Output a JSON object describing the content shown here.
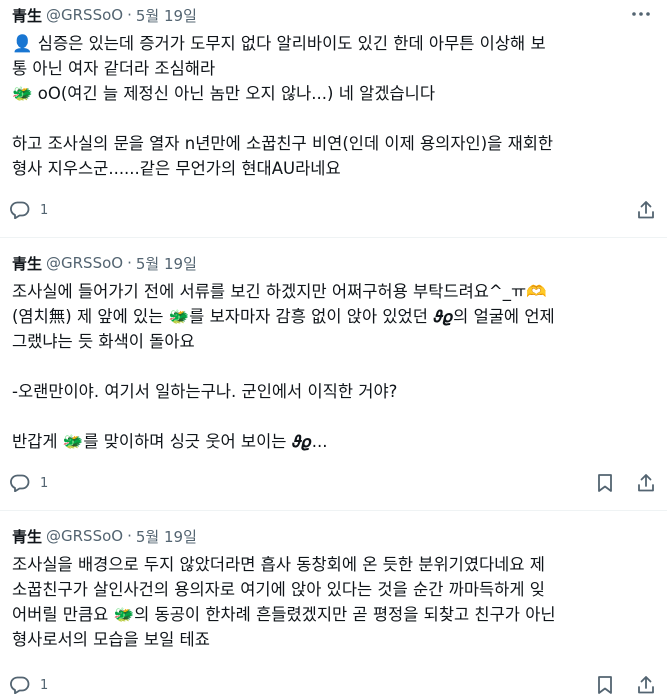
{
  "tweets": [
    {
      "name": "青生",
      "handle": "@GRSSoO",
      "dot": "·",
      "date": "5월 19일",
      "lines": [
        "👤 심증은 있는데 증거가 도무지 없다 알리바이도 있긴 한데 아무튼 이상해 보",
        "통 아닌 여자 같더라 조심해라",
        "🐲 oO(여긴 늘 제정신 아닌 놈만 오지 않나...) 네 알겠습니다",
        "",
        "하고 조사실의 문을 열자 n년만에 소꿉친구 비연(인데 이제 용의자인)을 재회한",
        "형사 지우스군......같은 무언가의 현대AU라네요"
      ],
      "reply_count": "1"
    },
    {
      "name": "青生",
      "handle": "@GRSSoO",
      "dot": "·",
      "date": "5월 19일",
      "lines": [
        "조사실에 들어가기 전에 서류를 보긴 하겠지만 어쩌구허용 부탁드려요^_ㅠ🫶",
        "(염치無) 제 앞에 있는 🐲를 보자마자 감흥 없이 앉아 있었던 𝝑𝝔의 얼굴에 언제",
        "그랬냐는 듯 화색이 돌아요",
        "",
        "-오랜만이야. 여기서 일하는구나. 군인에서 이직한 거야?",
        "",
        "반갑게 🐲를 맞이하며 싱긋 웃어 보이는 𝝑𝝔..."
      ],
      "reply_count": "1"
    },
    {
      "name": "青生",
      "handle": "@GRSSoO",
      "dot": "·",
      "date": "5월 19일",
      "lines": [
        "조사실을 배경으로 두지 않았더라면 흡사 동창회에 온 듯한 분위기였다네요 제",
        "소꿉친구가 살인사건의 용의자로 여기에 앉아 있다는 것을 순간 까마득하게 잊",
        "어버릴 만큼요 🐲의 동공이 한차례 흔들렸겠지만 곧 평정을 되찾고 친구가 아닌",
        "형사로서의 모습을 보일 테죠"
      ],
      "reply_count": "1"
    }
  ],
  "icons": {
    "more": "more-icon",
    "reply": "reply-icon",
    "share": "share-icon",
    "bookmark": "bookmark-icon"
  },
  "colors": {
    "text": "#0f1419",
    "secondary": "#536471",
    "divider": "#eff3f4"
  }
}
